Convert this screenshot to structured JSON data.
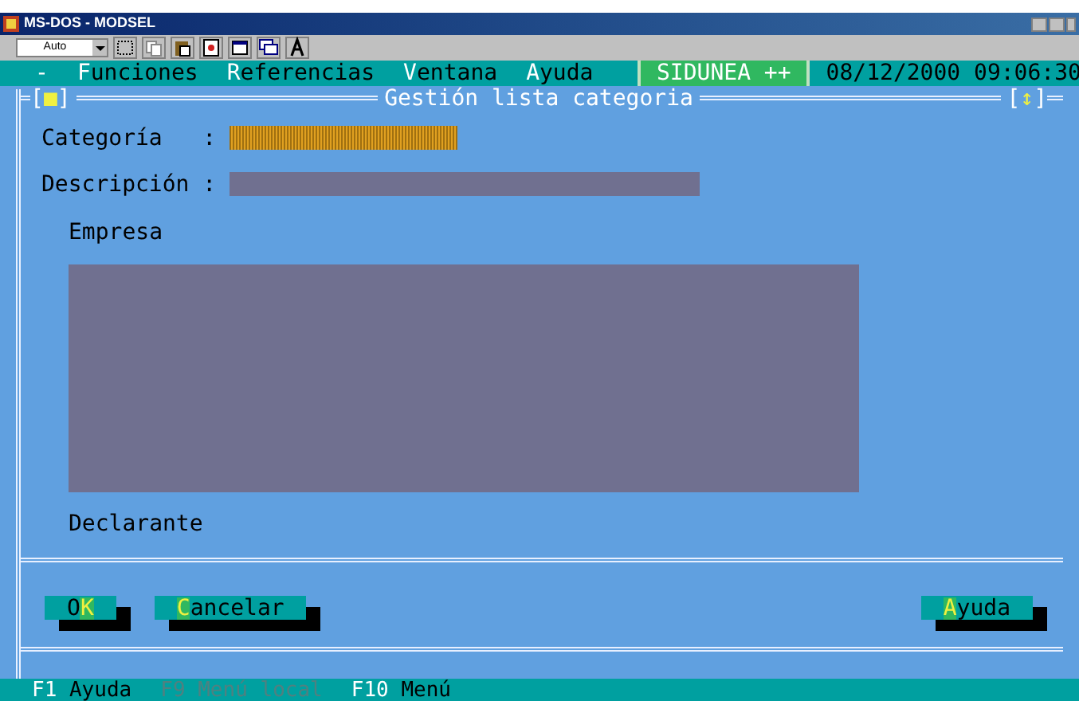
{
  "window": {
    "title": "MS-DOS - MODSEL"
  },
  "toolbar": {
    "font_size": "Auto"
  },
  "menu": [
    {
      "parts": [
        {
          "text": "-",
          "hot": true
        }
      ]
    },
    {
      "parts": [
        {
          "text": "F",
          "hot": true
        },
        {
          "text": "unciones",
          "hot": false
        }
      ]
    },
    {
      "parts": [
        {
          "text": "R",
          "hot": true
        },
        {
          "text": "eferencias",
          "hot": false
        }
      ]
    },
    {
      "parts": [
        {
          "text": "V",
          "hot": true
        },
        {
          "text": "entana",
          "hot": false
        }
      ]
    },
    {
      "parts": [
        {
          "text": "A",
          "hot": true
        },
        {
          "text": "yuda",
          "hot": false
        }
      ]
    }
  ],
  "app_name": "SIDUNEA ++",
  "datetime": "08/12/2000 09:06:30",
  "dialog": {
    "title": "Gestión lista categoria",
    "close_box": [
      {
        "text": "[",
        "hot": false
      },
      {
        "text": "■",
        "hot": true
      },
      {
        "text": "]",
        "hot": false
      }
    ],
    "resize_box": [
      {
        "text": "[",
        "hot": false
      },
      {
        "text": "↕",
        "hot": true
      },
      {
        "text": "]",
        "hot": false
      }
    ],
    "fields": [
      {
        "label": "Categoría   :",
        "kind": "pattern"
      },
      {
        "label": "Descripción :",
        "kind": "plain"
      }
    ],
    "empresa_label": "Empresa",
    "declarante_label": "Declarante",
    "buttons": [
      {
        "parts": [
          {
            "text": "O",
            "hot": false
          },
          {
            "text": "K",
            "hot": true
          }
        ]
      },
      {
        "parts": [
          {
            "text": "C",
            "hot": true
          },
          {
            "text": "ancelar",
            "hot": false
          }
        ]
      },
      {
        "parts": [
          {
            "text": "A",
            "hot": true
          },
          {
            "text": "yuda",
            "hot": false
          }
        ]
      }
    ]
  },
  "status_bar": [
    {
      "key": "F1",
      "label": "Ayuda",
      "disabled": false
    },
    {
      "key": "F9",
      "label": "Menú local",
      "disabled": true
    },
    {
      "key": "F10",
      "label": "Menú",
      "disabled": false
    }
  ]
}
